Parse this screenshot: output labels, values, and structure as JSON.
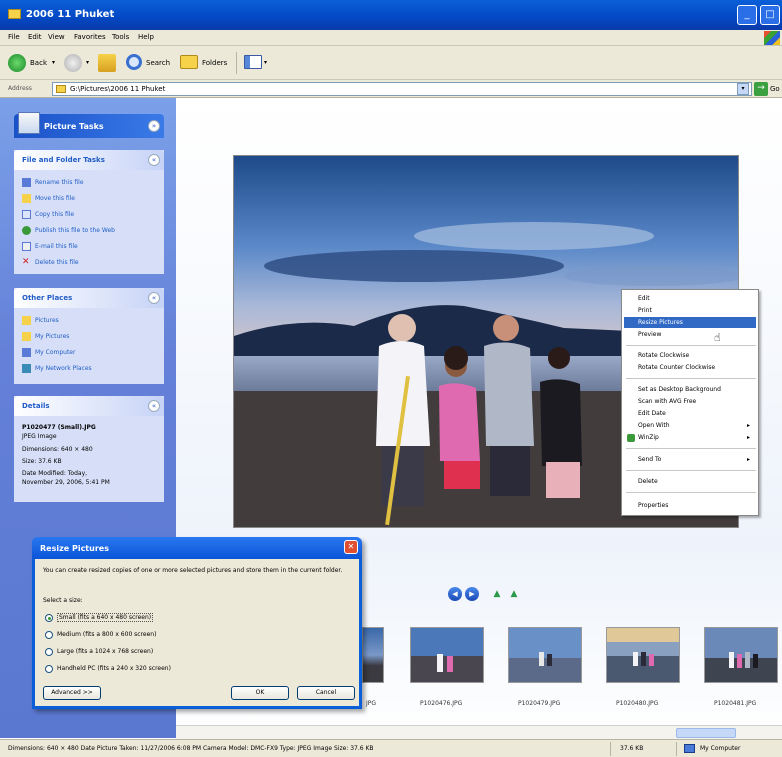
{
  "window": {
    "title": "2006 11 Phuket"
  },
  "menu": [
    "File",
    "Edit",
    "View",
    "Favorites",
    "Tools",
    "Help"
  ],
  "toolbar": {
    "back": "Back",
    "search": "Search",
    "folders": "Folders"
  },
  "address": {
    "label": "Address",
    "path": "G:\\Pictures\\2006 11 Phuket",
    "go": "Go"
  },
  "left_pane": {
    "picture_tasks": "Picture Tasks",
    "file_folder_tasks": {
      "title": "File and Folder Tasks",
      "items": [
        "Rename this file",
        "Move this file",
        "Copy this file",
        "Publish this file to the Web",
        "E-mail this file",
        "Delete this file"
      ]
    },
    "other_places": {
      "title": "Other Places",
      "items": [
        "Pictures",
        "My Pictures",
        "My Computer",
        "My Network Places"
      ]
    },
    "details": {
      "title": "Details",
      "filename": "P1020477 (Small).JPG",
      "type": "JPEG Image",
      "dimensions": "Dimensions: 640 × 480",
      "size": "Size: 37.6 KB",
      "date_modified_1": "Date Modified: Today,",
      "date_modified_2": "November 29, 2006, 5:41 PM"
    }
  },
  "context_menu": {
    "items": [
      "Edit",
      "Print",
      "Resize Pictures",
      "Preview",
      "Rotate Clockwise",
      "Rotate Counter Clockwise",
      "Set as Desktop Background",
      "Scan with AVG Free",
      "Edit Date",
      "Open With",
      "WinZip",
      "Send To",
      "Delete",
      "Properties"
    ],
    "highlighted": "Resize Pictures"
  },
  "filmstrip": {
    "labels": [
      "P1020476.JPG",
      "P1020479.JPG",
      "P1020480.JPG",
      "P1020481.JPG"
    ],
    "partial_label": "JPG"
  },
  "dialog": {
    "title": "Resize Pictures",
    "description": "You can create resized copies of one or more selected pictures and store them in the current folder.",
    "select_size": "Select a size:",
    "options": [
      "Small (fits a 640 x 480 screen)",
      "Medium (fits a 800 x 600 screen)",
      "Large (fits a 1024 x 768 screen)",
      "Handheld PC (fits a 240 x 320 screen)"
    ],
    "selected_index": 0,
    "advanced": "Advanced >>",
    "ok": "OK",
    "cancel": "Cancel"
  },
  "status": {
    "text": "Dimensions: 640 × 480 Date Picture Taken: 11/27/2006 6:08 PM Camera Model: DMC-FX9 Type: JPEG Image Size: 37.6 KB",
    "size": "37.6 KB",
    "location": "My Computer"
  }
}
